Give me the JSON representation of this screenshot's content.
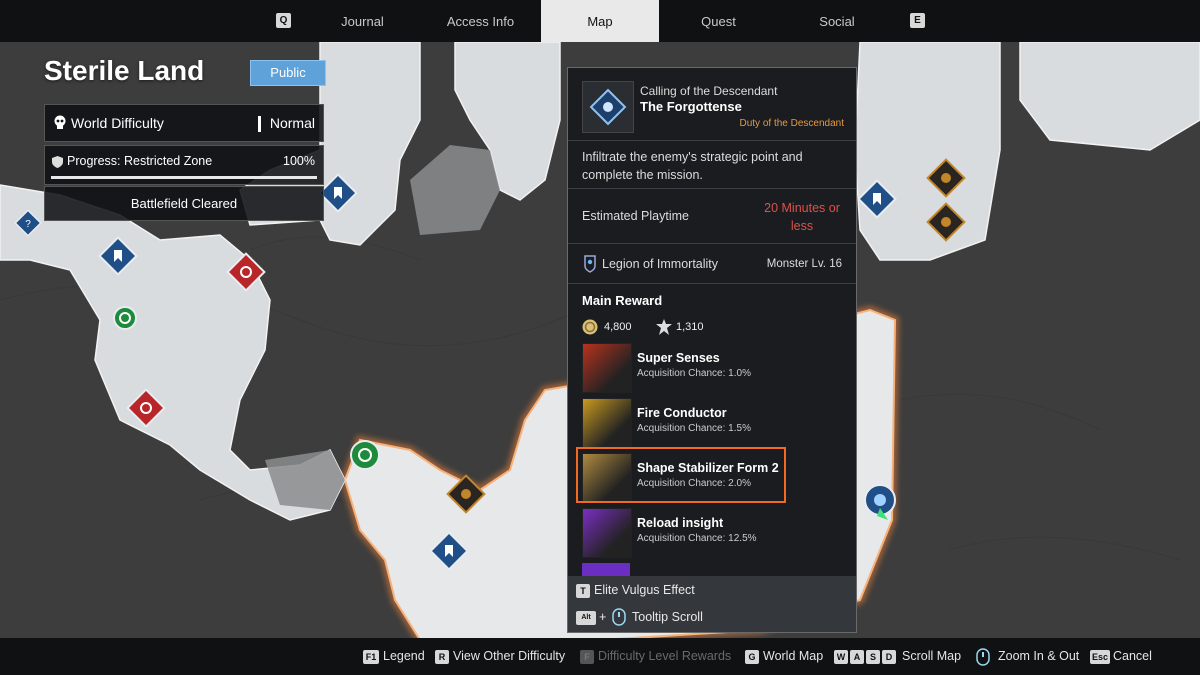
{
  "nav": {
    "left_key": "Q",
    "right_key": "E",
    "tabs": [
      {
        "label": "Journal"
      },
      {
        "label": "Access Info"
      },
      {
        "label": "Map"
      },
      {
        "label": "Quest"
      },
      {
        "label": "Social"
      }
    ],
    "active_tab": "Map"
  },
  "region": {
    "name": "Sterile Land",
    "visibility": "Public"
  },
  "difficulty": {
    "label": "World Difficulty",
    "value": "Normal"
  },
  "progress": {
    "label": "Progress: Restricted Zone",
    "value": "100%",
    "fraction": 1.0
  },
  "status": {
    "label": "Battlefield Cleared"
  },
  "mission": {
    "subtitle": "Calling of the Descendant",
    "title": "The Forgottense",
    "duty": "Duty of the Descendant",
    "description": "Infiltrate the enemy's strategic point and complete the mission.",
    "playtime_label": "Estimated Playtime",
    "playtime_value": "20 Minutes or less",
    "faction": "Legion of Immortality",
    "monster_level": "Monster Lv. 16",
    "main_reward_label": "Main Reward",
    "gold": "4,800",
    "xp": "1,310",
    "rewards": [
      {
        "name": "Super Senses",
        "chance": "Acquisition Chance: 1.0%",
        "color": "#b8321e"
      },
      {
        "name": "Fire Conductor",
        "chance": "Acquisition Chance: 1.5%",
        "color": "#c99a1f"
      },
      {
        "name": "Shape Stabilizer Form 2",
        "chance": "Acquisition Chance: 2.0%",
        "color": "#b08a3e"
      },
      {
        "name": "Reload insight",
        "chance": "Acquisition Chance: 12.5%",
        "color": "#7a2fc2"
      }
    ],
    "footer": {
      "elite_key": "T",
      "elite_label": "Elite Vulgus Effect",
      "alt_key": "Alt",
      "plus": "+",
      "scroll_label": "Tooltip Scroll"
    }
  },
  "bottom_bar": [
    {
      "key": "F1",
      "label": "Legend",
      "enabled": true
    },
    {
      "key": "R",
      "label": "View Other Difficulty",
      "enabled": true
    },
    {
      "key": "F",
      "label": "Difficulty Level Rewards",
      "enabled": false
    },
    {
      "key": "G",
      "label": "World Map",
      "enabled": true
    },
    {
      "keys": [
        "W",
        "A",
        "S",
        "D"
      ],
      "label": "Scroll Map",
      "enabled": true
    },
    {
      "key": "zoom-icon",
      "label": "Zoom In & Out",
      "enabled": true
    },
    {
      "key": "Esc",
      "label": "Cancel",
      "enabled": true
    }
  ],
  "colors": {
    "accent_orange": "#f06a23",
    "public_blue": "#5ea2d9",
    "playtime_red": "#e0504a",
    "duty_orange": "#e39a45",
    "marker_blue": "#1f4f86",
    "marker_red": "#b8262a",
    "marker_green": "#1e8a3c",
    "marker_gold": "#c2862a"
  }
}
